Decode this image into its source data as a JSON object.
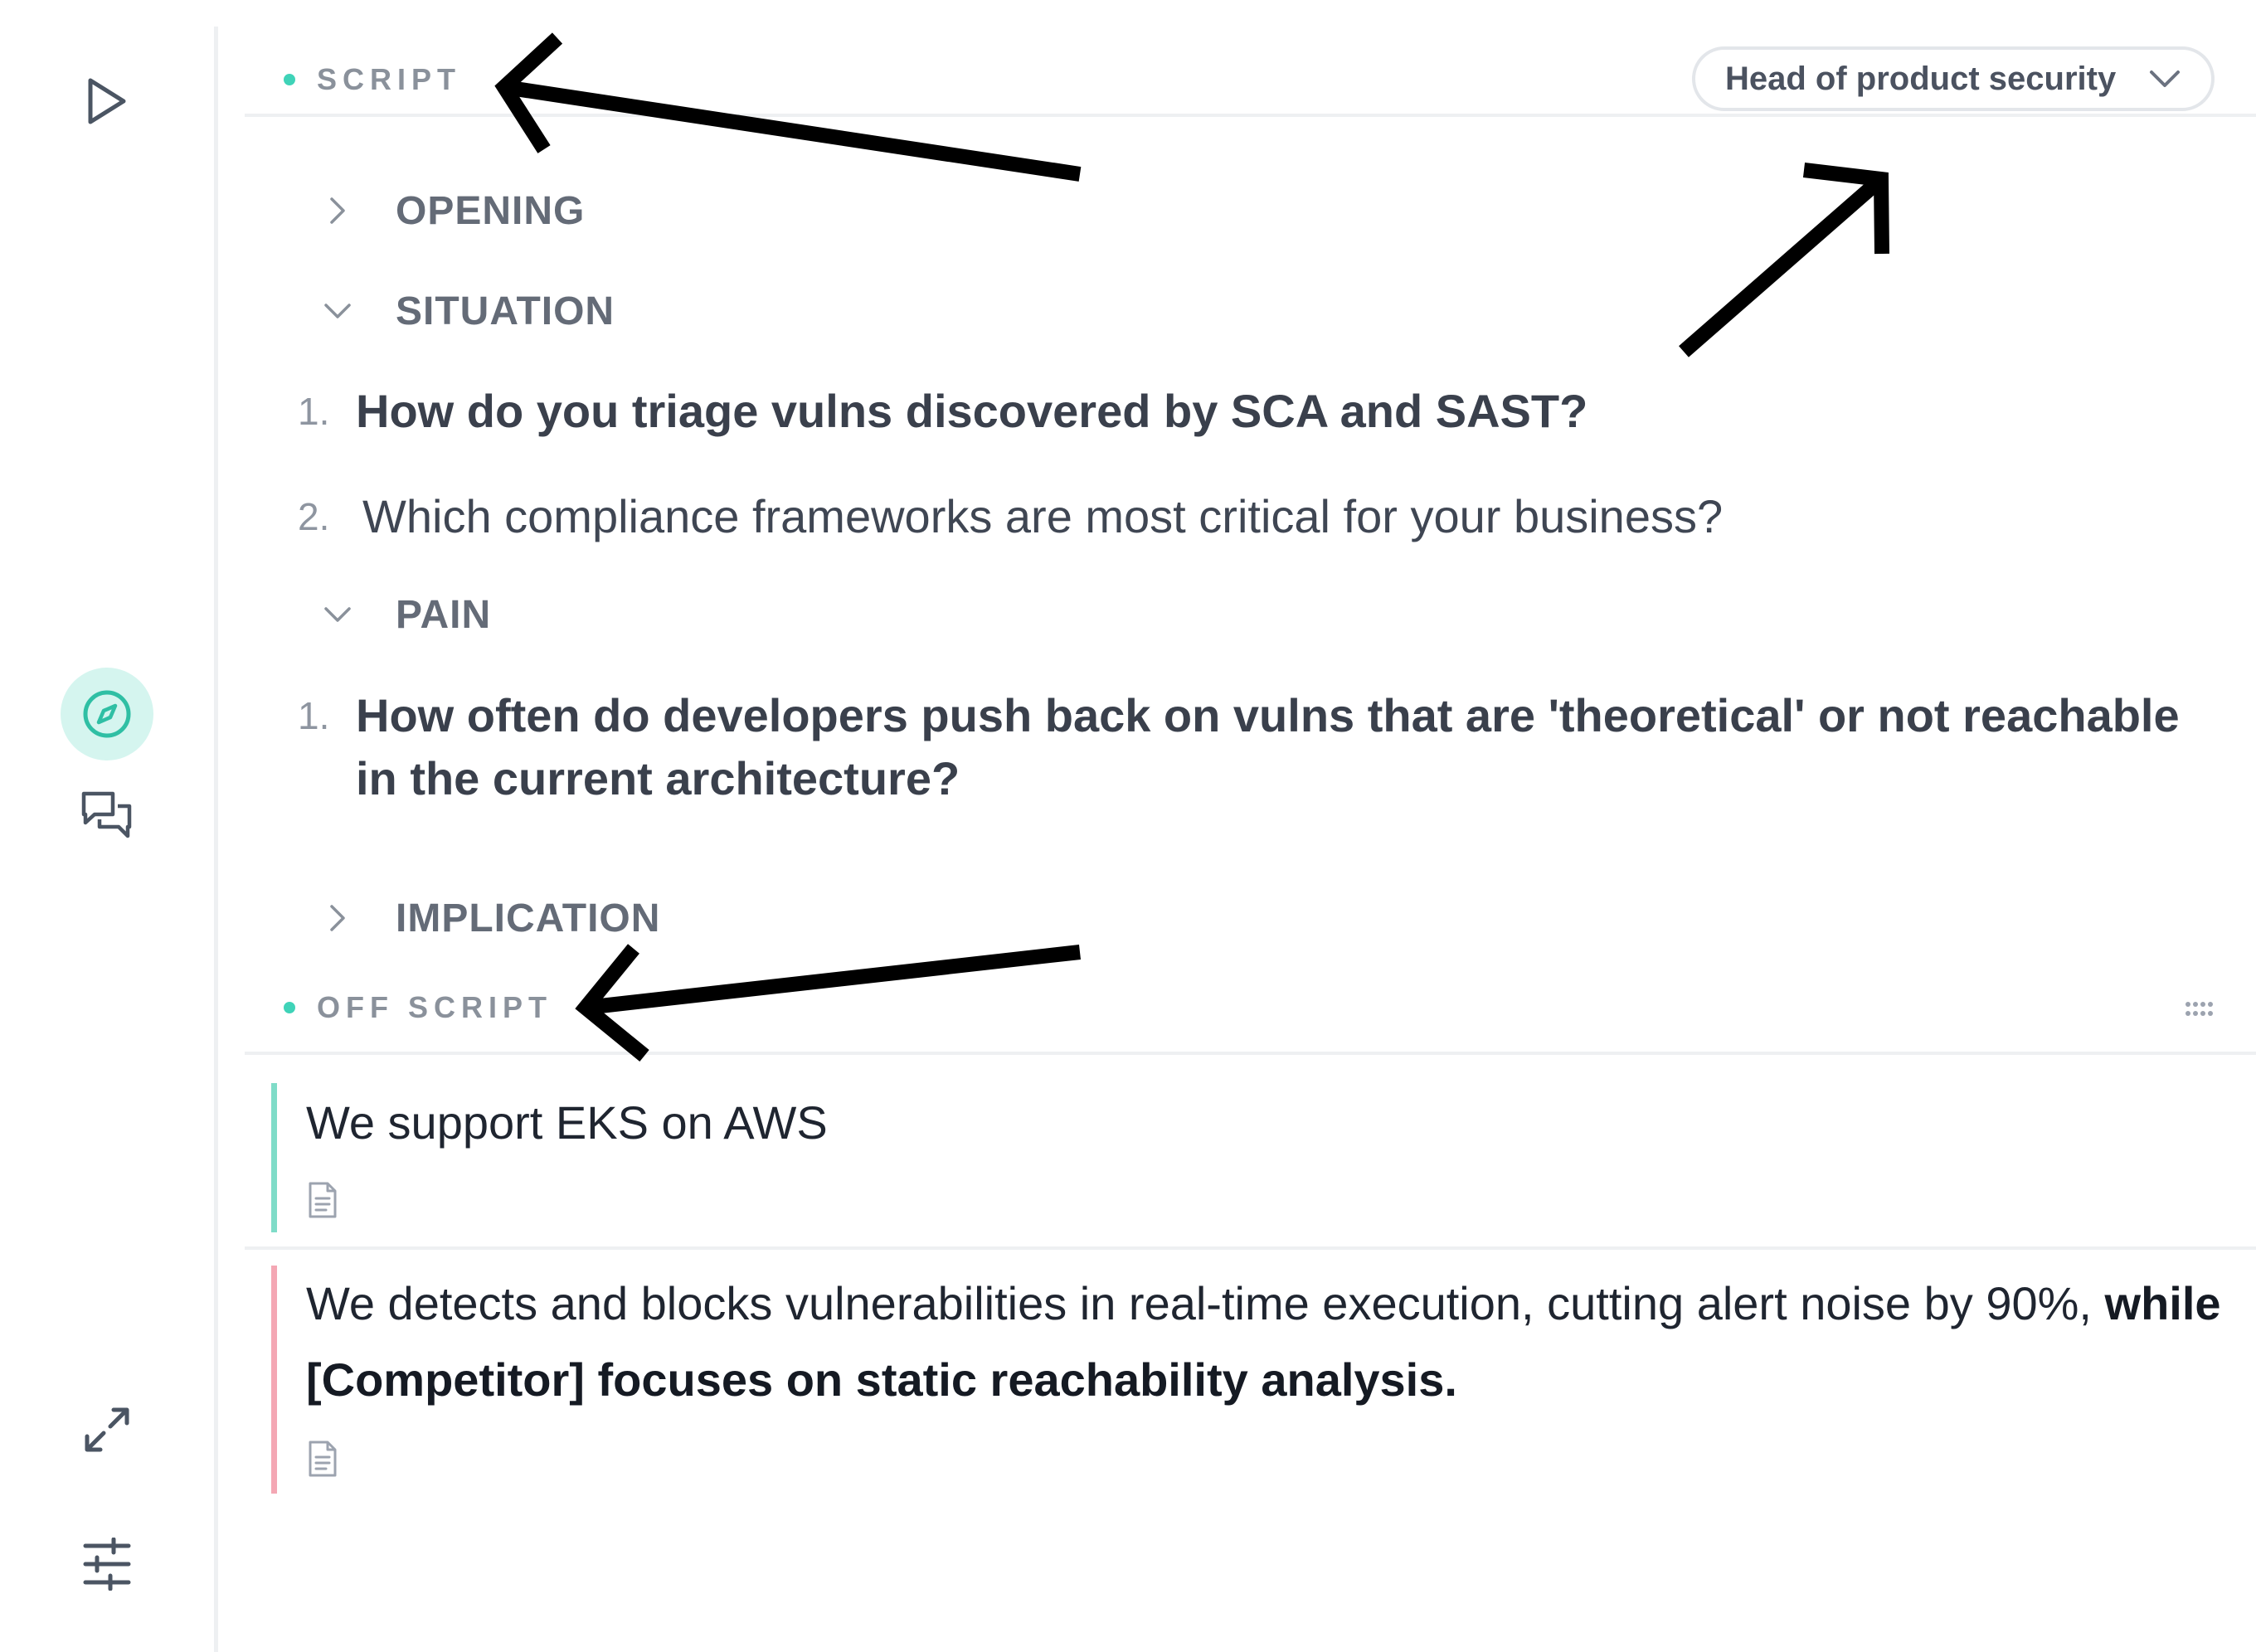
{
  "sidebar": {
    "items": [
      {
        "name": "play",
        "icon": "play-icon"
      },
      {
        "name": "compass",
        "icon": "compass-icon",
        "active": true
      },
      {
        "name": "chat",
        "icon": "chat-bubbles-icon"
      },
      {
        "name": "expand",
        "icon": "expand-arrows-icon"
      },
      {
        "name": "settings",
        "icon": "sliders-icon"
      }
    ],
    "accent": "#3fd3b8",
    "active_bg": "#d5f5ef"
  },
  "script": {
    "title": "SCRIPT",
    "persona": {
      "selected": "Head of product security",
      "icon": "chevron-down-icon"
    },
    "groups": [
      {
        "label": "OPENING",
        "expanded": false
      },
      {
        "label": "SITUATION",
        "expanded": true,
        "questions": [
          {
            "num": "1.",
            "text": "How do you triage vulns discovered by SCA and SAST?",
            "bold": true
          },
          {
            "num": "2.",
            "text": "Which compliance frameworks are most critical for your business?",
            "bold": false
          }
        ]
      },
      {
        "label": "PAIN",
        "expanded": true,
        "questions": [
          {
            "num": "1.",
            "text": "How often do developers push back on vulns that are 'theoretical' or not reachable in the current architecture?",
            "bold": true
          }
        ]
      },
      {
        "label": "IMPLICATION",
        "expanded": false
      }
    ]
  },
  "off_script": {
    "title": "OFF SCRIPT",
    "menu_icon": "drag-handle-icon",
    "cards": [
      {
        "text": "We support EKS on AWS",
        "accent": "#7fdcc8",
        "icon": "document-icon"
      },
      {
        "text_plain": "We detects and blocks vulnerabilities in real-time execution, cutting alert noise by 90%, ",
        "text_bold": "while [Competitor] focuses on static reachability analysis.",
        "accent": "#f4a7b4",
        "icon": "document-icon"
      }
    ]
  }
}
